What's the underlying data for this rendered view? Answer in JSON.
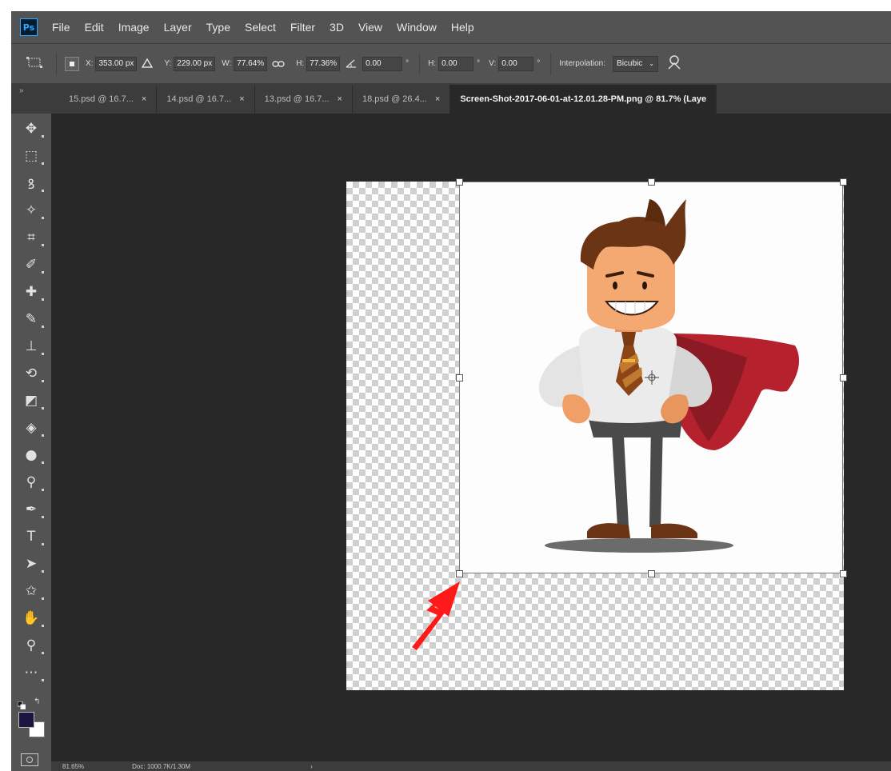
{
  "menu": [
    "File",
    "Edit",
    "Image",
    "Layer",
    "Type",
    "Select",
    "Filter",
    "3D",
    "View",
    "Window",
    "Help"
  ],
  "app_logo": "Ps",
  "options": {
    "x_label": "X:",
    "x_value": "353.00 px",
    "delta_icon": "delta-icon",
    "y_label": "Y:",
    "y_value": "229.00 px",
    "w_label": "W:",
    "w_value": "77.64%",
    "link_icon": "link-icon",
    "h_label": "H:",
    "h_value": "77.36%",
    "angle_value": "0.00",
    "angle_unit": "°",
    "hskew_label": "H:",
    "hskew_value": "0.00",
    "hskew_unit": "°",
    "vskew_label": "V:",
    "vskew_value": "0.00",
    "vskew_unit": "°",
    "interp_label": "Interpolation:",
    "interp_value": "Bicubic",
    "warp_icon": "warp-icon"
  },
  "panel_toggle": "»",
  "tabs": [
    {
      "label": "15.psd @ 16.7...",
      "close": "×"
    },
    {
      "label": "14.psd @ 16.7...",
      "close": "×"
    },
    {
      "label": "13.psd @ 16.7...",
      "close": "×"
    },
    {
      "label": "18.psd @ 26.4...",
      "close": "×"
    },
    {
      "label": "Screen-Shot-2017-06-01-at-12.01.28-PM.png @ 81.7% (Laye",
      "close": ""
    }
  ],
  "tools": [
    {
      "name": "move-tool-icon",
      "glyph": "✥"
    },
    {
      "name": "marquee-tool-icon",
      "glyph": "⬚"
    },
    {
      "name": "lasso-tool-icon",
      "glyph": "ꝸ"
    },
    {
      "name": "magic-wand-icon",
      "glyph": "✧"
    },
    {
      "name": "crop-tool-icon",
      "glyph": "⌗"
    },
    {
      "name": "eyedropper-icon",
      "glyph": "✐"
    },
    {
      "name": "healing-brush-icon",
      "glyph": "✚"
    },
    {
      "name": "brush-tool-icon",
      "glyph": "✎"
    },
    {
      "name": "clone-stamp-icon",
      "glyph": "⊥"
    },
    {
      "name": "history-brush-icon",
      "glyph": "⟲"
    },
    {
      "name": "eraser-tool-icon",
      "glyph": "◩"
    },
    {
      "name": "paint-bucket-icon",
      "glyph": "◈"
    },
    {
      "name": "blur-tool-icon",
      "glyph": "●"
    },
    {
      "name": "dodge-tool-icon",
      "glyph": "⚲"
    },
    {
      "name": "pen-tool-icon",
      "glyph": "✒"
    },
    {
      "name": "type-tool-icon",
      "glyph": "T"
    },
    {
      "name": "path-select-icon",
      "glyph": "➤"
    },
    {
      "name": "custom-shape-icon",
      "glyph": "✩"
    },
    {
      "name": "hand-tool-icon",
      "glyph": "✋"
    },
    {
      "name": "zoom-tool-icon",
      "glyph": "⚲"
    },
    {
      "name": "more-tools-icon",
      "glyph": "⋯"
    }
  ],
  "status": {
    "zoom": "81.65%",
    "doc": "Doc: 1000.7K/1.30M",
    "arrow": "›"
  },
  "colors": {
    "foreground": "#1b1540",
    "background": "#ffffff",
    "annotation_arrow": "#ff1a1a"
  }
}
